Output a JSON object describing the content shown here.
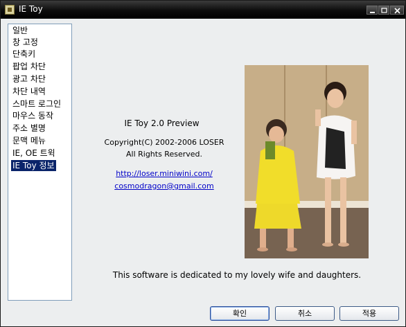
{
  "window": {
    "title": "IE Toy"
  },
  "sidebar": {
    "items": [
      {
        "label": "일반"
      },
      {
        "label": "창 고정"
      },
      {
        "label": "단축키"
      },
      {
        "label": "팝업 차단"
      },
      {
        "label": "광고 차단"
      },
      {
        "label": "차단 내역"
      },
      {
        "label": "스마트 로그인"
      },
      {
        "label": "마우스 동작"
      },
      {
        "label": "주소 별명"
      },
      {
        "label": "문맥 메뉴"
      },
      {
        "label": "IE, OE 트윅"
      },
      {
        "label": "IE Toy 정보"
      }
    ],
    "selected_index": 11
  },
  "about": {
    "product": "IE Toy 2.0 Preview",
    "copyright": "Copyright(C) 2002-2006 LOSER",
    "rights": "All Rights Reserved.",
    "website": "http://loser.miniwini.com/",
    "email": "cosmodragon@gmail.com",
    "dedication": "This software is dedicated to my lovely wife and daughters."
  },
  "buttons": {
    "ok": "확인",
    "cancel": "취소",
    "apply": "적용"
  },
  "colors": {
    "selection": "#0a246a",
    "link": "#0000c8",
    "panel": "#eceeef"
  }
}
